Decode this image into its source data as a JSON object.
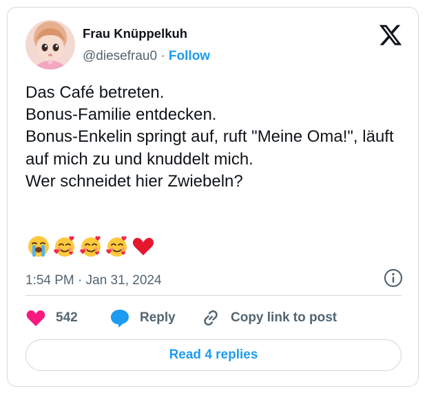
{
  "author": {
    "name": "Frau Knüppelkuh",
    "handle": "@diesefrau0",
    "separator": "·",
    "follow_label": "Follow"
  },
  "tweet": {
    "text": "Das Café betreten.\nBonus-Familie entdecken.\nBonus-Enkelin springt auf, ruft \"Meine Oma!\", läuft auf mich zu und knuddelt mich.\nWer schneidet hier Zwiebeln?",
    "emojis": [
      "loudly-crying-face",
      "smiling-face-with-hearts",
      "smiling-face-with-hearts",
      "smiling-face-with-hearts",
      "red-heart"
    ],
    "timestamp": "1:54 PM · Jan 31, 2024"
  },
  "actions": {
    "like_count": "542",
    "reply_label": "Reply",
    "copy_link_label": "Copy link to post"
  },
  "read_replies_label": "Read 4 replies",
  "colors": {
    "accent": "#1d9bf0",
    "like": "#f91880",
    "text": "#0f1419",
    "muted": "#536471",
    "border": "#cfd9de"
  },
  "icons": [
    "x-logo-icon",
    "info-icon",
    "heart-icon",
    "reply-bubble-icon",
    "link-icon"
  ]
}
